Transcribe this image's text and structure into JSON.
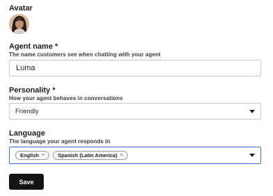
{
  "avatar": {
    "label": "Avatar"
  },
  "agent_name": {
    "label": "Agent name *",
    "help": "The name customers see when chatting with your agent",
    "value": "Luma"
  },
  "personality": {
    "label": "Personality *",
    "help": "How your agent behaves in conversations",
    "selected": "Friendly"
  },
  "language": {
    "label": "Language",
    "help": "The language your agent responds in",
    "chips": [
      "English",
      "Spanish (Latin America)"
    ],
    "chip_remove": "×"
  },
  "actions": {
    "save_label": "Save"
  },
  "colors": {
    "focus_border": "#3a74d6",
    "button_bg": "#141414"
  }
}
